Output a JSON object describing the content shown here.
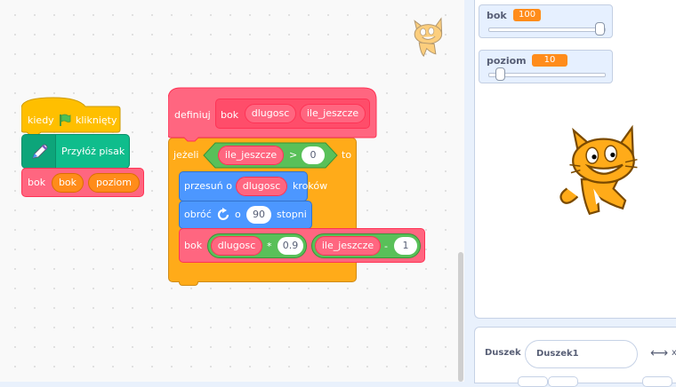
{
  "hat_block": {
    "text_before": "kiedy",
    "flag_icon": "green-flag-icon",
    "text_after": "kliknięty"
  },
  "pen_block": {
    "icon": "pen-icon",
    "label": "Przyłóż pisak"
  },
  "call_block": {
    "label": "bok",
    "arg1": "bok",
    "arg2": "poziom"
  },
  "define_block": {
    "label": "definiuj",
    "proc_name": "bok",
    "param1": "dlugosc",
    "param2": "ile_jeszcze"
  },
  "if_block": {
    "label": "jeżeli",
    "cond_var": "ile_jeszcze",
    "operator": ">",
    "cond_value": "0",
    "then_label": "to"
  },
  "move_block": {
    "label_before": "przesuń o",
    "arg": "dlugosc",
    "label_after": "kroków"
  },
  "turn_block": {
    "label_before": "obróć",
    "icon": "turn-right-icon",
    "label_mid": "o",
    "value": "90",
    "label_after": "stopni"
  },
  "recursive_call": {
    "label": "bok",
    "arg1_var": "dlugosc",
    "arg1_op": "*",
    "arg1_value": "0.9",
    "arg2_var": "ile_jeszcze",
    "arg2_op": "-",
    "arg2_value": "1"
  },
  "monitors": [
    {
      "name": "bok",
      "value": "100",
      "slider_fraction": 1.0
    },
    {
      "name": "poziom",
      "value": "10",
      "slider_fraction": 0.0
    }
  ],
  "sprite_info": {
    "label": "Duszek",
    "name_value": "Duszek1",
    "x_label": "x"
  },
  "colors": {
    "events": "#ffbf00",
    "pen": "#0fbd8c",
    "custom": "#ff6680",
    "control": "#ffab19",
    "motion": "#4c97ff",
    "operators": "#59c059",
    "variable": "#ff8c1a"
  }
}
